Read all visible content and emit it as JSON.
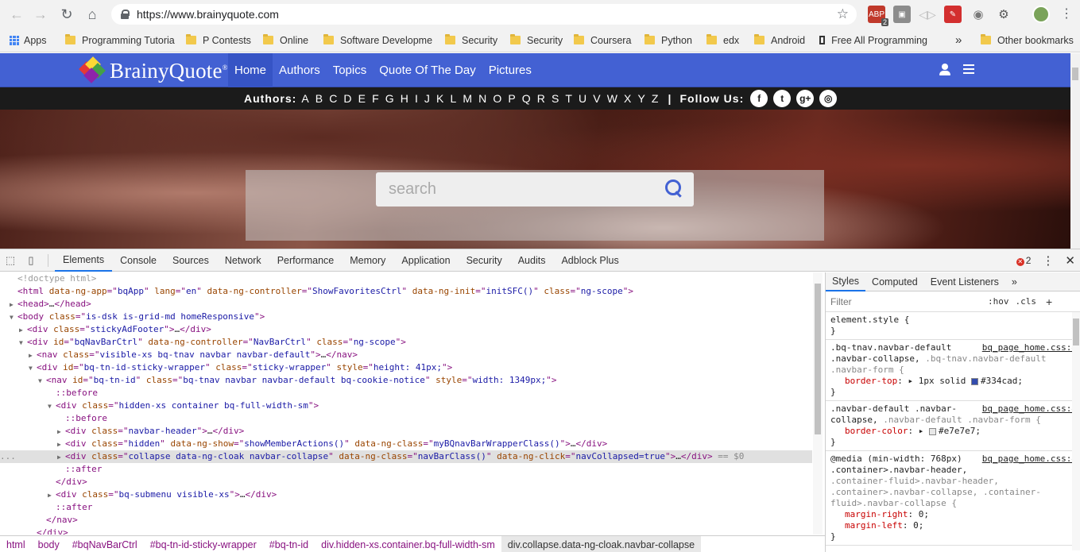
{
  "browser": {
    "url": "https://www.brainyquote.com",
    "extension_badge": "2"
  },
  "bookmarks": [
    {
      "label": "Apps",
      "type": "apps"
    },
    {
      "label": "Programming Tutoria",
      "type": "folder"
    },
    {
      "label": "P Contests",
      "type": "folder"
    },
    {
      "label": "Online",
      "type": "folder"
    },
    {
      "label": "Software Developme",
      "type": "folder"
    },
    {
      "label": "Security",
      "type": "folder"
    },
    {
      "label": "Security",
      "type": "folder"
    },
    {
      "label": "Coursera",
      "type": "folder"
    },
    {
      "label": "Python",
      "type": "folder"
    },
    {
      "label": "edx",
      "type": "folder"
    },
    {
      "label": "Android",
      "type": "folder"
    },
    {
      "label": "Free All Programming",
      "type": "page"
    }
  ],
  "bookmarks_overflow": "»",
  "other_bookmarks": "Other bookmarks",
  "site": {
    "logo_text": "BrainyQuote",
    "logo_mark": "®",
    "menu": [
      {
        "label": "Home",
        "active": true
      },
      {
        "label": "Authors",
        "active": false
      },
      {
        "label": "Topics",
        "active": false
      },
      {
        "label": "Quote Of The Day",
        "active": false
      },
      {
        "label": "Pictures",
        "active": false
      }
    ],
    "authors_label": "Authors:",
    "letters": [
      "A",
      "B",
      "C",
      "D",
      "E",
      "F",
      "G",
      "H",
      "I",
      "J",
      "K",
      "L",
      "M",
      "N",
      "O",
      "P",
      "Q",
      "R",
      "S",
      "T",
      "U",
      "V",
      "W",
      "X",
      "Y",
      "Z"
    ],
    "separator": "|",
    "follow_label": "Follow Us:",
    "social": [
      {
        "icon": "facebook-icon",
        "glyph": "f"
      },
      {
        "icon": "twitter-icon",
        "glyph": "t"
      },
      {
        "icon": "google-plus-icon",
        "glyph": "g+"
      },
      {
        "icon": "instagram-icon",
        "glyph": "◎"
      }
    ],
    "search_placeholder": "search",
    "nav_color": "#4361d3"
  },
  "devtools": {
    "tabs": [
      "Elements",
      "Console",
      "Sources",
      "Network",
      "Performance",
      "Memory",
      "Application",
      "Security",
      "Audits",
      "Adblock Plus"
    ],
    "active_tab": "Elements",
    "error_count": "2",
    "dom_lines": [
      {
        "indent": 0,
        "tri": "",
        "parts": [
          [
            "comment",
            "<!doctype html>"
          ]
        ]
      },
      {
        "indent": 0,
        "tri": "",
        "parts": [
          [
            "tag",
            "<html "
          ],
          [
            "attr-n",
            "data-ng-app"
          ],
          [
            "tag",
            "=\""
          ],
          [
            "attr-v",
            "bqApp"
          ],
          [
            "tag",
            "\" "
          ],
          [
            "attr-n",
            "lang"
          ],
          [
            "tag",
            "=\""
          ],
          [
            "attr-v",
            "en"
          ],
          [
            "tag",
            "\" "
          ],
          [
            "attr-n",
            "data-ng-controller"
          ],
          [
            "tag",
            "=\""
          ],
          [
            "attr-v",
            "ShowFavoritesCtrl"
          ],
          [
            "tag",
            "\" "
          ],
          [
            "attr-n",
            "data-ng-init"
          ],
          [
            "tag",
            "=\""
          ],
          [
            "attr-v",
            "initSFC()"
          ],
          [
            "tag",
            "\" "
          ],
          [
            "attr-n",
            "class"
          ],
          [
            "tag",
            "=\""
          ],
          [
            "attr-v",
            "ng-scope"
          ],
          [
            "tag",
            "\">"
          ]
        ]
      },
      {
        "indent": 0,
        "tri": "▶",
        "parts": [
          [
            "tag",
            "<head>"
          ],
          [
            "txt",
            "…"
          ],
          [
            "tag",
            "</head>"
          ]
        ]
      },
      {
        "indent": 0,
        "tri": "▼",
        "parts": [
          [
            "tag",
            "<body "
          ],
          [
            "attr-n",
            "class"
          ],
          [
            "tag",
            "=\""
          ],
          [
            "attr-v",
            "is-dsk is-grid-md homeResponsive"
          ],
          [
            "tag",
            "\">"
          ]
        ]
      },
      {
        "indent": 1,
        "tri": "▶",
        "parts": [
          [
            "tag",
            "<div "
          ],
          [
            "attr-n",
            "class"
          ],
          [
            "tag",
            "=\""
          ],
          [
            "attr-v",
            "stickyAdFooter"
          ],
          [
            "tag",
            "\">"
          ],
          [
            "txt",
            "…"
          ],
          [
            "tag",
            "</div>"
          ]
        ]
      },
      {
        "indent": 1,
        "tri": "▼",
        "parts": [
          [
            "tag",
            "<div "
          ],
          [
            "attr-n",
            "id"
          ],
          [
            "tag",
            "=\""
          ],
          [
            "attr-v",
            "bqNavBarCtrl"
          ],
          [
            "tag",
            "\" "
          ],
          [
            "attr-n",
            "data-ng-controller"
          ],
          [
            "tag",
            "=\""
          ],
          [
            "attr-v",
            "NavBarCtrl"
          ],
          [
            "tag",
            "\" "
          ],
          [
            "attr-n",
            "class"
          ],
          [
            "tag",
            "=\""
          ],
          [
            "attr-v",
            "ng-scope"
          ],
          [
            "tag",
            "\">"
          ]
        ]
      },
      {
        "indent": 2,
        "tri": "▶",
        "parts": [
          [
            "tag",
            "<nav "
          ],
          [
            "attr-n",
            "class"
          ],
          [
            "tag",
            "=\""
          ],
          [
            "attr-v",
            "visible-xs bq-tnav navbar navbar-default"
          ],
          [
            "tag",
            "\">"
          ],
          [
            "txt",
            "…"
          ],
          [
            "tag",
            "</nav>"
          ]
        ]
      },
      {
        "indent": 2,
        "tri": "▼",
        "parts": [
          [
            "tag",
            "<div "
          ],
          [
            "attr-n",
            "id"
          ],
          [
            "tag",
            "=\""
          ],
          [
            "attr-v",
            "bq-tn-id-sticky-wrapper"
          ],
          [
            "tag",
            "\" "
          ],
          [
            "attr-n",
            "class"
          ],
          [
            "tag",
            "=\""
          ],
          [
            "attr-v",
            "sticky-wrapper"
          ],
          [
            "tag",
            "\" "
          ],
          [
            "attr-n",
            "style"
          ],
          [
            "tag",
            "=\""
          ],
          [
            "attr-v",
            "height: 41px;"
          ],
          [
            "tag",
            "\">"
          ]
        ]
      },
      {
        "indent": 3,
        "tri": "▼",
        "parts": [
          [
            "tag",
            "<nav "
          ],
          [
            "attr-n",
            "id"
          ],
          [
            "tag",
            "=\""
          ],
          [
            "attr-v",
            "bq-tn-id"
          ],
          [
            "tag",
            "\" "
          ],
          [
            "attr-n",
            "class"
          ],
          [
            "tag",
            "=\""
          ],
          [
            "attr-v",
            "bq-tnav navbar navbar-default bq-cookie-notice"
          ],
          [
            "tag",
            "\" "
          ],
          [
            "attr-n",
            "style"
          ],
          [
            "tag",
            "=\""
          ],
          [
            "attr-v",
            "width: 1349px;"
          ],
          [
            "tag",
            "\">"
          ]
        ]
      },
      {
        "indent": 4,
        "tri": "",
        "parts": [
          [
            "pseudo",
            "::before"
          ]
        ]
      },
      {
        "indent": 4,
        "tri": "▼",
        "parts": [
          [
            "tag",
            "<div "
          ],
          [
            "attr-n",
            "class"
          ],
          [
            "tag",
            "=\""
          ],
          [
            "attr-v",
            "hidden-xs container bq-full-width-sm"
          ],
          [
            "tag",
            "\">"
          ]
        ]
      },
      {
        "indent": 5,
        "tri": "",
        "parts": [
          [
            "pseudo",
            "::before"
          ]
        ]
      },
      {
        "indent": 5,
        "tri": "▶",
        "parts": [
          [
            "tag",
            "<div "
          ],
          [
            "attr-n",
            "class"
          ],
          [
            "tag",
            "=\""
          ],
          [
            "attr-v",
            "navbar-header"
          ],
          [
            "tag",
            "\">"
          ],
          [
            "txt",
            "…"
          ],
          [
            "tag",
            "</div>"
          ]
        ]
      },
      {
        "indent": 5,
        "tri": "▶",
        "parts": [
          [
            "tag",
            "<div "
          ],
          [
            "attr-n",
            "class"
          ],
          [
            "tag",
            "=\""
          ],
          [
            "attr-v",
            "hidden"
          ],
          [
            "tag",
            "\" "
          ],
          [
            "attr-n",
            "data-ng-show"
          ],
          [
            "tag",
            "=\""
          ],
          [
            "attr-v",
            "showMemberActions()"
          ],
          [
            "tag",
            "\" "
          ],
          [
            "attr-n",
            "data-ng-class"
          ],
          [
            "tag",
            "=\""
          ],
          [
            "attr-v",
            "myBQnavBarWrapperClass()"
          ],
          [
            "tag",
            "\">"
          ],
          [
            "txt",
            "…"
          ],
          [
            "tag",
            "</div>"
          ]
        ]
      },
      {
        "indent": 5,
        "tri": "▶",
        "selected": true,
        "parts": [
          [
            "tag",
            "<div "
          ],
          [
            "attr-n",
            "class"
          ],
          [
            "tag",
            "=\""
          ],
          [
            "attr-v",
            "collapse data-ng-cloak navbar-collapse"
          ],
          [
            "tag",
            "\" "
          ],
          [
            "attr-n",
            "data-ng-class"
          ],
          [
            "tag",
            "=\""
          ],
          [
            "attr-v",
            "navBarClass()"
          ],
          [
            "tag",
            "\" "
          ],
          [
            "attr-n",
            "data-ng-click"
          ],
          [
            "tag",
            "=\""
          ],
          [
            "attr-v",
            "navCollapsed=true"
          ],
          [
            "tag",
            "\">"
          ],
          [
            "txt",
            "…"
          ],
          [
            "tag",
            "</div>"
          ],
          [
            "dollar",
            " == $0"
          ]
        ]
      },
      {
        "indent": 5,
        "tri": "",
        "parts": [
          [
            "pseudo",
            "::after"
          ]
        ]
      },
      {
        "indent": 4,
        "tri": "",
        "parts": [
          [
            "tag",
            "</div>"
          ]
        ]
      },
      {
        "indent": 4,
        "tri": "▶",
        "parts": [
          [
            "tag",
            "<div "
          ],
          [
            "attr-n",
            "class"
          ],
          [
            "tag",
            "=\""
          ],
          [
            "attr-v",
            "bq-submenu visible-xs"
          ],
          [
            "tag",
            "\">"
          ],
          [
            "txt",
            "…"
          ],
          [
            "tag",
            "</div>"
          ]
        ]
      },
      {
        "indent": 4,
        "tri": "",
        "parts": [
          [
            "pseudo",
            "::after"
          ]
        ]
      },
      {
        "indent": 3,
        "tri": "",
        "parts": [
          [
            "tag",
            "</nav>"
          ]
        ]
      },
      {
        "indent": 2,
        "tri": "",
        "parts": [
          [
            "tag",
            "</div>"
          ]
        ]
      }
    ],
    "selected_marker": "...",
    "breadcrumbs": [
      "html",
      "body",
      "#bqNavBarCtrl",
      "#bq-tn-id-sticky-wrapper",
      "#bq-tn-id",
      "div.hidden-xs.container.bq-full-width-sm",
      "div.collapse.data-ng-cloak.navbar-collapse"
    ],
    "styles_tabs": [
      "Styles",
      "Computed",
      "Event Listeners",
      "»"
    ],
    "filter_placeholder": "Filter",
    "hov": ":hov",
    "cls": ".cls",
    "plus": "+",
    "rules": [
      {
        "selector": "element.style {",
        "src": "",
        "lines": [],
        "close": "}"
      },
      {
        "selector": ".bq-tnav.navbar-default",
        "selector2": ".navbar-collapse, ",
        "selector2b": ".bq-tnav.navbar-default",
        "selector3": ".navbar-form {",
        "src": "bq_page_home.css:4",
        "lines": [
          {
            "name": "border-top",
            "value": "1px solid ",
            "swatch": "#334cad",
            "swatch_text": "#334cad;"
          }
        ],
        "close": "}"
      },
      {
        "selector": ".navbar-default .navbar-",
        "selector2": "collapse, ",
        "selector2b": ".navbar-default .navbar-form {",
        "selector3": "",
        "src": "bq_page_home.css:4",
        "lines": [
          {
            "name": "border-color",
            "value": "",
            "swatch": "#e7e7e7",
            "swatch_text": "#e7e7e7;"
          }
        ],
        "close": "}"
      },
      {
        "selector": "@media (min-width: 768px)",
        "selector2": ".container>.navbar-header, ",
        "selector2b": "",
        "selector3": ".container-fluid>.navbar-header, .container>.navbar-collapse, .container-fluid>.navbar-collapse {",
        "src": "bq_page_home.css:4",
        "lines": [
          {
            "name": "margin-right",
            "value": "0;",
            "swatch": "",
            "swatch_text": ""
          },
          {
            "name": "margin-left",
            "value": "0;",
            "swatch": "",
            "swatch_text": ""
          }
        ],
        "close": "}"
      }
    ]
  }
}
